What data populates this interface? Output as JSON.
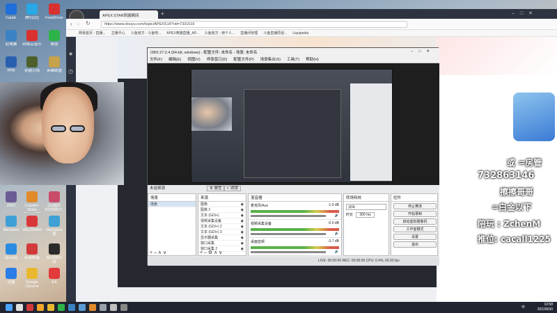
{
  "desktop": {
    "icons": [
      {
        "label": "CatalL",
        "color": "#1e6fd9"
      },
      {
        "label": "腾讯QQ",
        "color": "#2aa7e5"
      },
      {
        "label": "FreeDriver",
        "color": "#d93030"
      },
      {
        "label": "此电脑",
        "color": "#3b82c4"
      },
      {
        "label": "网易云音乐",
        "color": "#d93030"
      },
      {
        "label": "微信",
        "color": "#2db34a"
      },
      {
        "label": "PPB",
        "color": "#2a5fb0"
      },
      {
        "label": "穿越火线",
        "color": "#4d5f2c"
      },
      {
        "label": "英雄联盟",
        "color": "#c6a24a"
      },
      {
        "label": "2022",
        "color": "#6b5b95"
      },
      {
        "label": "Counter-Strike Global Off",
        "color": "#e08a2a"
      },
      {
        "label": "QQ图片20220817...",
        "color": "#c94b6a"
      },
      {
        "label": "WeGame",
        "color": "#3fa0d6"
      },
      {
        "label": "VALORANT",
        "color": "#d9383a"
      },
      {
        "label": "WeGame版",
        "color": "#3fa0d6"
      },
      {
        "label": "QuickQ",
        "color": "#2a8be0"
      },
      {
        "label": "网易邮箱",
        "color": "#d23a3a"
      },
      {
        "label": "5E对战平台",
        "color": "#2a2a2a"
      },
      {
        "label": "迅雷",
        "color": "#2b7de8"
      },
      {
        "label": "Google Chrome",
        "color": "#e9b830"
      },
      {
        "label": "EA",
        "color": "#e23a3a"
      }
    ]
  },
  "browser": {
    "tab_title": "APEX:STAR刺激瞬间",
    "url": "https://www.douyu.com/topic/APEXS14?rid=7331519",
    "bookmarks": [
      "网易首页 - 直播...",
      "主播中心",
      "斗鱼官方 - 斗鱼吧...",
      "APEX英雄直播_AP...",
      "斗鱼官方 - 用个人...",
      "直播间管理",
      "斗鱼直播原创...",
      "Liquipedia"
    ]
  },
  "obs": {
    "title": "OBS 27.2.4 (64-bit, windows) - 配置文件: 未命名 - 场景: 未命名",
    "menu": [
      "文件(F)",
      "编辑(E)",
      "视图(V)",
      "停靠窗口(D)",
      "配置文件(P)",
      "场景集合(S)",
      "工具(T)",
      "帮助(H)"
    ],
    "no_source": "未选择源",
    "props_label": "属性",
    "filters_label": "滤镜",
    "scenes_header": "场景",
    "scenes": [
      "场景"
    ],
    "sources_header": "来源",
    "sources": [
      "图像",
      "图像 2",
      "文本 (GDI+)",
      "视频采集设备",
      "文本 (GDI+) 2",
      "文本 (GDI+) 3",
      "显示器采集",
      "窗口采集",
      "窗口采集 2"
    ],
    "mixer_header": "混音器",
    "mixer": [
      {
        "name": "麦克风/Aux",
        "db": "-1.9 dB"
      },
      {
        "name": "视频采集设备",
        "db": "-0.0 dB"
      },
      {
        "name": "桌面音频",
        "db": "-3.7 dB"
      }
    ],
    "transitions_header": "转场特效",
    "transition_type": "淡出",
    "duration_label": "时长",
    "duration_value": "300 ms",
    "controls_header": "控件",
    "controls": [
      "停止推流",
      "开始录制",
      "启动虚拟摄像机",
      "工作室模式",
      "设置",
      "退出"
    ],
    "status": "LIVE: 00:00:00    REC: 00:00:00    CPU: 0.4%, 60.00 fps"
  },
  "overlay": {
    "line1": "或 =房管",
    "line2": "732863146",
    "line3": "擦擦哥哥",
    "line4": "=白金以下",
    "line5": "陪玩 : ZchenM",
    "line6": "推位: cacall1225"
  },
  "taskbar": {
    "time": "10:58",
    "date": "2022/8/30",
    "lang": "中"
  }
}
